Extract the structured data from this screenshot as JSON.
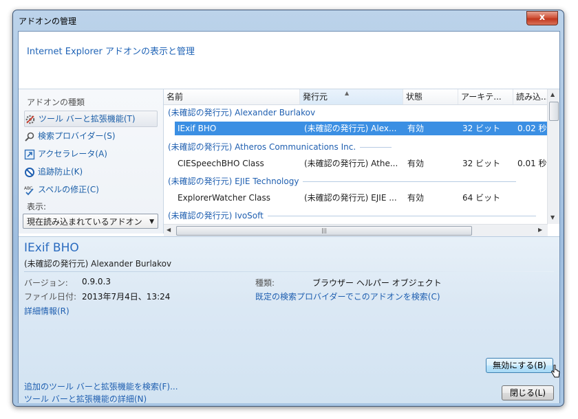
{
  "window": {
    "title": "アドオンの管理",
    "close_glyph": "x"
  },
  "header": {
    "title": "Internet Explorer アドオンの表示と管理"
  },
  "sidebar": {
    "heading": "アドオンの種類",
    "items": [
      {
        "label": "ツール バーと拡張機能(T)",
        "icon": "gear-icon"
      },
      {
        "label": "検索プロバイダー(S)",
        "icon": "search-icon"
      },
      {
        "label": "アクセラレータ(A)",
        "icon": "accelerator-icon"
      },
      {
        "label": "追跡防止(K)",
        "icon": "tracking-protection-icon"
      },
      {
        "label": "スペルの修正(C)",
        "icon": "spelling-icon"
      }
    ],
    "show_label": "表示:",
    "show_value": "現在読み込まれているアドオン"
  },
  "list": {
    "columns": [
      "名前",
      "発行元",
      "状態",
      "アーキテ...",
      "読み込..."
    ],
    "groups": [
      {
        "label": "(未確認の発行元) Alexander Burlakov",
        "rows": [
          {
            "name": "IExif BHO",
            "publisher": "(未確認の発行元) Alex...",
            "status": "有効",
            "arch": "32 ビット",
            "load": "0.02 秒",
            "selected": true
          }
        ]
      },
      {
        "label": "(未確認の発行元) Atheros Communications Inc.",
        "rows": [
          {
            "name": "CIESpeechBHO Class",
            "publisher": "(未確認の発行元) Athe...",
            "status": "有効",
            "arch": "32 ビット",
            "load": "0.01 秒",
            "selected": false
          }
        ]
      },
      {
        "label": "(未確認の発行元) EJIE Technology",
        "rows": [
          {
            "name": "ExplorerWatcher Class",
            "publisher": "(未確認の発行元) EJIE ...",
            "status": "有効",
            "arch": "64 ビット",
            "load": "",
            "selected": false
          }
        ]
      },
      {
        "label": "(未確認の発行元) IvoSoft",
        "rows": []
      }
    ]
  },
  "details": {
    "name": "IExif BHO",
    "publisher": "(未確認の発行元) Alexander Burlakov",
    "version_label": "バージョン:",
    "version_value": "0.9.0.3",
    "date_label": "ファイル日付:",
    "date_value": "2013年7月4日、13:24",
    "more_info": "詳細情報(R)",
    "type_label": "種類:",
    "type_value": "ブラウザー ヘルパー オブジェクト",
    "search_link": "既定の検索プロバイダーでこのアドオンを検索(C)",
    "disable_button": "無効にする(B)",
    "find_more_link": "追加のツール バーと拡張機能を検索(F)...",
    "learn_more_link": "ツール バーと拡張機能の詳細(N)",
    "close_button": "閉じる(L)"
  }
}
